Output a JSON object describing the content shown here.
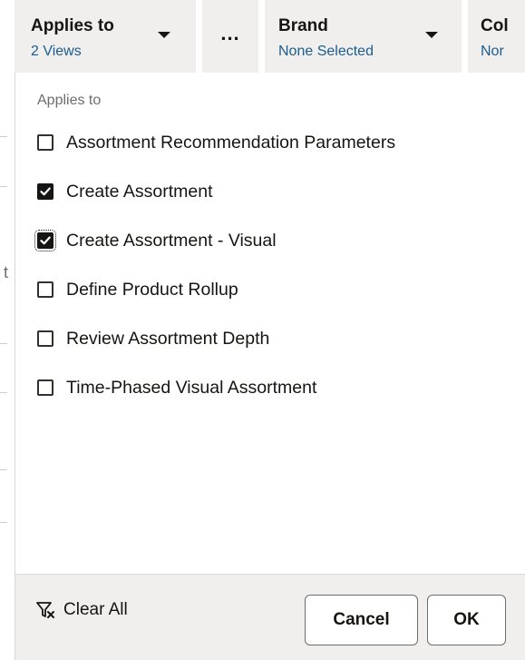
{
  "filters": [
    {
      "title": "Applies to",
      "value": "2 Views"
    },
    {
      "title": "Brand",
      "value": "None Selected"
    },
    {
      "title": "Col",
      "value": "Nor"
    }
  ],
  "more": {
    "label": "...",
    "icon": "more-horizontal-icon"
  },
  "panel": {
    "heading": "Applies to",
    "options": [
      {
        "label": "Assortment Recommendation Parameters",
        "checked": false
      },
      {
        "label": "Create Assortment",
        "checked": true
      },
      {
        "label": "Create Assortment - Visual",
        "checked": true
      },
      {
        "label": "Define Product Rollup",
        "checked": false
      },
      {
        "label": "Review Assortment Depth",
        "checked": false
      },
      {
        "label": "Time-Phased Visual Assortment",
        "checked": false
      }
    ]
  },
  "footer": {
    "clear_all": "Clear All",
    "clear_icon": "filter-clear-icon",
    "cancel": "Cancel",
    "ok": "OK"
  },
  "background": {
    "edge_char": "t"
  },
  "colors": {
    "accent_link": "#1a5d8f",
    "chip_bg": "#f1efed",
    "text": "#161513"
  }
}
